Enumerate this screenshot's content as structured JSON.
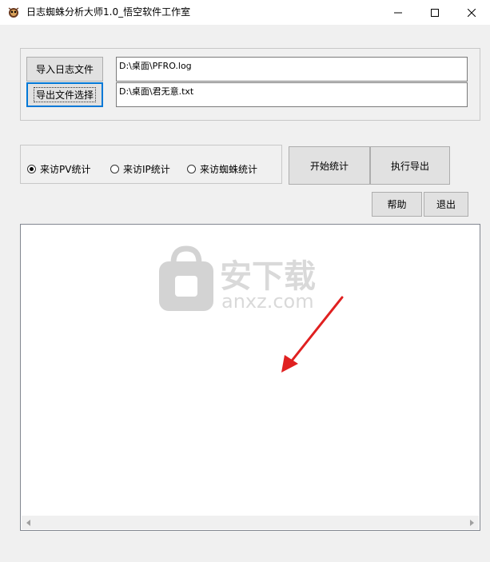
{
  "window": {
    "title": "日志蜘蛛分析大师1.0_悟空软件工作室",
    "icon": "spider-icon",
    "controls": [
      "minimize-icon",
      "maximize-icon",
      "close-icon"
    ]
  },
  "files": {
    "import_label": "导入日志文件",
    "export_label": "导出文件选择",
    "import_path": "D:\\桌面\\PFRO.log",
    "export_path": "D:\\桌面\\君无意.txt"
  },
  "stats_mode": {
    "options": [
      {
        "label": "来访PV统计",
        "selected": true
      },
      {
        "label": "来访IP统计",
        "selected": false
      },
      {
        "label": "来访蜘蛛统计",
        "selected": false
      }
    ]
  },
  "actions": {
    "start_label": "开始统计",
    "export_label": "执行导出",
    "help_label": "帮助",
    "exit_label": "退出"
  },
  "output": {
    "text": ""
  },
  "watermark": {
    "text": "安下载",
    "sub": "anxz.com"
  },
  "colors": {
    "accent": "#0078d7",
    "arrow": "#e02020"
  }
}
